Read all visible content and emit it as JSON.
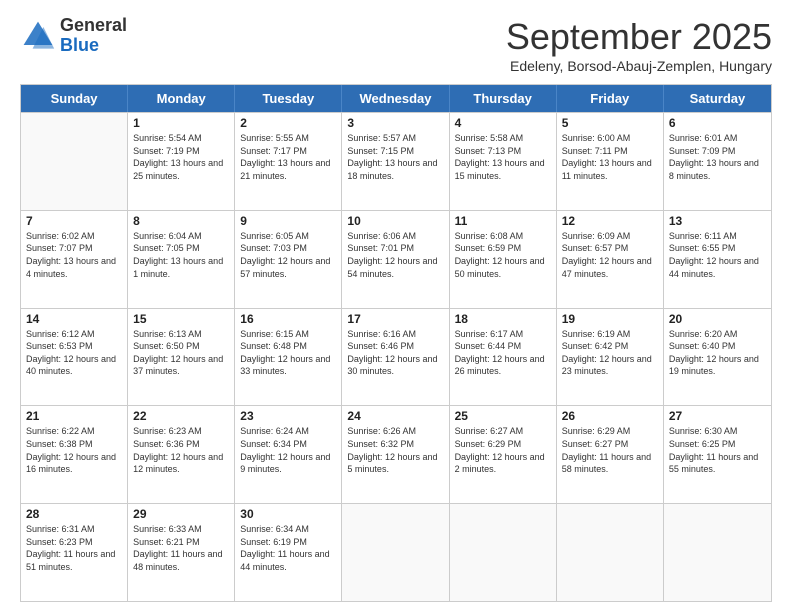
{
  "header": {
    "logo_general": "General",
    "logo_blue": "Blue",
    "month_title": "September 2025",
    "subtitle": "Edeleny, Borsod-Abauj-Zemplen, Hungary"
  },
  "weekdays": [
    "Sunday",
    "Monday",
    "Tuesday",
    "Wednesday",
    "Thursday",
    "Friday",
    "Saturday"
  ],
  "rows": [
    [
      {
        "day": "",
        "sunrise": "",
        "sunset": "",
        "daylight": ""
      },
      {
        "day": "1",
        "sunrise": "Sunrise: 5:54 AM",
        "sunset": "Sunset: 7:19 PM",
        "daylight": "Daylight: 13 hours and 25 minutes."
      },
      {
        "day": "2",
        "sunrise": "Sunrise: 5:55 AM",
        "sunset": "Sunset: 7:17 PM",
        "daylight": "Daylight: 13 hours and 21 minutes."
      },
      {
        "day": "3",
        "sunrise": "Sunrise: 5:57 AM",
        "sunset": "Sunset: 7:15 PM",
        "daylight": "Daylight: 13 hours and 18 minutes."
      },
      {
        "day": "4",
        "sunrise": "Sunrise: 5:58 AM",
        "sunset": "Sunset: 7:13 PM",
        "daylight": "Daylight: 13 hours and 15 minutes."
      },
      {
        "day": "5",
        "sunrise": "Sunrise: 6:00 AM",
        "sunset": "Sunset: 7:11 PM",
        "daylight": "Daylight: 13 hours and 11 minutes."
      },
      {
        "day": "6",
        "sunrise": "Sunrise: 6:01 AM",
        "sunset": "Sunset: 7:09 PM",
        "daylight": "Daylight: 13 hours and 8 minutes."
      }
    ],
    [
      {
        "day": "7",
        "sunrise": "Sunrise: 6:02 AM",
        "sunset": "Sunset: 7:07 PM",
        "daylight": "Daylight: 13 hours and 4 minutes."
      },
      {
        "day": "8",
        "sunrise": "Sunrise: 6:04 AM",
        "sunset": "Sunset: 7:05 PM",
        "daylight": "Daylight: 13 hours and 1 minute."
      },
      {
        "day": "9",
        "sunrise": "Sunrise: 6:05 AM",
        "sunset": "Sunset: 7:03 PM",
        "daylight": "Daylight: 12 hours and 57 minutes."
      },
      {
        "day": "10",
        "sunrise": "Sunrise: 6:06 AM",
        "sunset": "Sunset: 7:01 PM",
        "daylight": "Daylight: 12 hours and 54 minutes."
      },
      {
        "day": "11",
        "sunrise": "Sunrise: 6:08 AM",
        "sunset": "Sunset: 6:59 PM",
        "daylight": "Daylight: 12 hours and 50 minutes."
      },
      {
        "day": "12",
        "sunrise": "Sunrise: 6:09 AM",
        "sunset": "Sunset: 6:57 PM",
        "daylight": "Daylight: 12 hours and 47 minutes."
      },
      {
        "day": "13",
        "sunrise": "Sunrise: 6:11 AM",
        "sunset": "Sunset: 6:55 PM",
        "daylight": "Daylight: 12 hours and 44 minutes."
      }
    ],
    [
      {
        "day": "14",
        "sunrise": "Sunrise: 6:12 AM",
        "sunset": "Sunset: 6:53 PM",
        "daylight": "Daylight: 12 hours and 40 minutes."
      },
      {
        "day": "15",
        "sunrise": "Sunrise: 6:13 AM",
        "sunset": "Sunset: 6:50 PM",
        "daylight": "Daylight: 12 hours and 37 minutes."
      },
      {
        "day": "16",
        "sunrise": "Sunrise: 6:15 AM",
        "sunset": "Sunset: 6:48 PM",
        "daylight": "Daylight: 12 hours and 33 minutes."
      },
      {
        "day": "17",
        "sunrise": "Sunrise: 6:16 AM",
        "sunset": "Sunset: 6:46 PM",
        "daylight": "Daylight: 12 hours and 30 minutes."
      },
      {
        "day": "18",
        "sunrise": "Sunrise: 6:17 AM",
        "sunset": "Sunset: 6:44 PM",
        "daylight": "Daylight: 12 hours and 26 minutes."
      },
      {
        "day": "19",
        "sunrise": "Sunrise: 6:19 AM",
        "sunset": "Sunset: 6:42 PM",
        "daylight": "Daylight: 12 hours and 23 minutes."
      },
      {
        "day": "20",
        "sunrise": "Sunrise: 6:20 AM",
        "sunset": "Sunset: 6:40 PM",
        "daylight": "Daylight: 12 hours and 19 minutes."
      }
    ],
    [
      {
        "day": "21",
        "sunrise": "Sunrise: 6:22 AM",
        "sunset": "Sunset: 6:38 PM",
        "daylight": "Daylight: 12 hours and 16 minutes."
      },
      {
        "day": "22",
        "sunrise": "Sunrise: 6:23 AM",
        "sunset": "Sunset: 6:36 PM",
        "daylight": "Daylight: 12 hours and 12 minutes."
      },
      {
        "day": "23",
        "sunrise": "Sunrise: 6:24 AM",
        "sunset": "Sunset: 6:34 PM",
        "daylight": "Daylight: 12 hours and 9 minutes."
      },
      {
        "day": "24",
        "sunrise": "Sunrise: 6:26 AM",
        "sunset": "Sunset: 6:32 PM",
        "daylight": "Daylight: 12 hours and 5 minutes."
      },
      {
        "day": "25",
        "sunrise": "Sunrise: 6:27 AM",
        "sunset": "Sunset: 6:29 PM",
        "daylight": "Daylight: 12 hours and 2 minutes."
      },
      {
        "day": "26",
        "sunrise": "Sunrise: 6:29 AM",
        "sunset": "Sunset: 6:27 PM",
        "daylight": "Daylight: 11 hours and 58 minutes."
      },
      {
        "day": "27",
        "sunrise": "Sunrise: 6:30 AM",
        "sunset": "Sunset: 6:25 PM",
        "daylight": "Daylight: 11 hours and 55 minutes."
      }
    ],
    [
      {
        "day": "28",
        "sunrise": "Sunrise: 6:31 AM",
        "sunset": "Sunset: 6:23 PM",
        "daylight": "Daylight: 11 hours and 51 minutes."
      },
      {
        "day": "29",
        "sunrise": "Sunrise: 6:33 AM",
        "sunset": "Sunset: 6:21 PM",
        "daylight": "Daylight: 11 hours and 48 minutes."
      },
      {
        "day": "30",
        "sunrise": "Sunrise: 6:34 AM",
        "sunset": "Sunset: 6:19 PM",
        "daylight": "Daylight: 11 hours and 44 minutes."
      },
      {
        "day": "",
        "sunrise": "",
        "sunset": "",
        "daylight": ""
      },
      {
        "day": "",
        "sunrise": "",
        "sunset": "",
        "daylight": ""
      },
      {
        "day": "",
        "sunrise": "",
        "sunset": "",
        "daylight": ""
      },
      {
        "day": "",
        "sunrise": "",
        "sunset": "",
        "daylight": ""
      }
    ]
  ]
}
